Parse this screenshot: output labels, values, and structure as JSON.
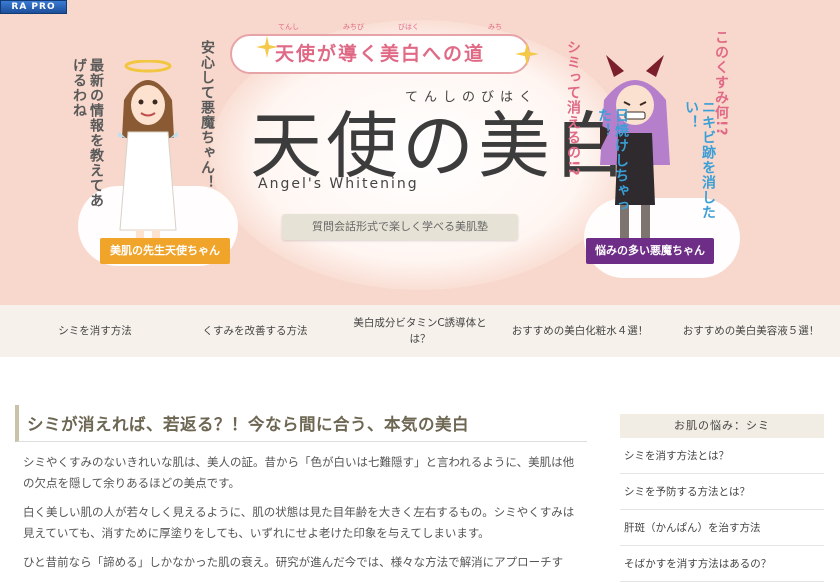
{
  "badge": "RA PRO",
  "header": {
    "catchphrase": "天使が導く美白への道",
    "ruby": [
      "てんし",
      "みちび",
      "びはく",
      "みち"
    ],
    "logo_kana": "てんしのびはく",
    "logo": "天使の美白",
    "logo_en": "Angel's Whitening",
    "ribbon": "質問会話形式で楽しく学べる美肌塾",
    "angel": {
      "speech_1": "安心して悪魔ちゃん！",
      "speech_2": "最新の情報を教えてあげるわね",
      "label": "美肌の先生天使ちゃん"
    },
    "devil": {
      "speech_1": "シミって消えるの!?",
      "speech_2": "日焼けしちゃった！",
      "speech_3": "このくすみ何!?",
      "speech_4": "ニキビ跡を消したい！",
      "label": "悩みの多い悪魔ちゃん"
    }
  },
  "nav": [
    {
      "label": "シミを消す方法"
    },
    {
      "label": "くすみを改善する方法"
    },
    {
      "label": "美白成分ビタミンC誘導体とは？"
    },
    {
      "label": "おすすめの美白化粧水４選！"
    },
    {
      "label": "おすすめの美白美容液５選！"
    }
  ],
  "main": {
    "heading": "シミが消えれば、若返る？！今なら間に合う、本気の美白",
    "paragraphs": [
      "シミやくすみのないきれいな肌は、美人の証。昔から「色が白いは七難隠す」と言われるように、美肌は他の欠点を隠して余りあるほどの美点です。",
      "白く美しい肌の人が若々しく見えるように、肌の状態は見た目年齢を大きく左右するもの。シミやくすみは見えていても、消すために厚塗りをしても、いずれにせよ老けた印象を与えてしまいます。",
      "ひと昔前なら「諦める」しかなかった肌の衰え。研究が進んだ今では、様々な方法で解消にアプローチす"
    ]
  },
  "sidebar": {
    "heading": "お肌の悩み：シミ",
    "items": [
      {
        "label": "シミを消す方法とは？"
      },
      {
        "label": "シミを予防する方法とは？"
      },
      {
        "label": "肝斑（かんぱん）を治す方法"
      },
      {
        "label": "そばかすを消す方法はあるの？"
      }
    ]
  },
  "colors": {
    "hero_bg": "#f8d8cc",
    "catch_pink": "#e06a86",
    "angel_banner": "#f0a52a",
    "devil_banner": "#6e2d86",
    "nav_bg": "#f6f2eb"
  }
}
